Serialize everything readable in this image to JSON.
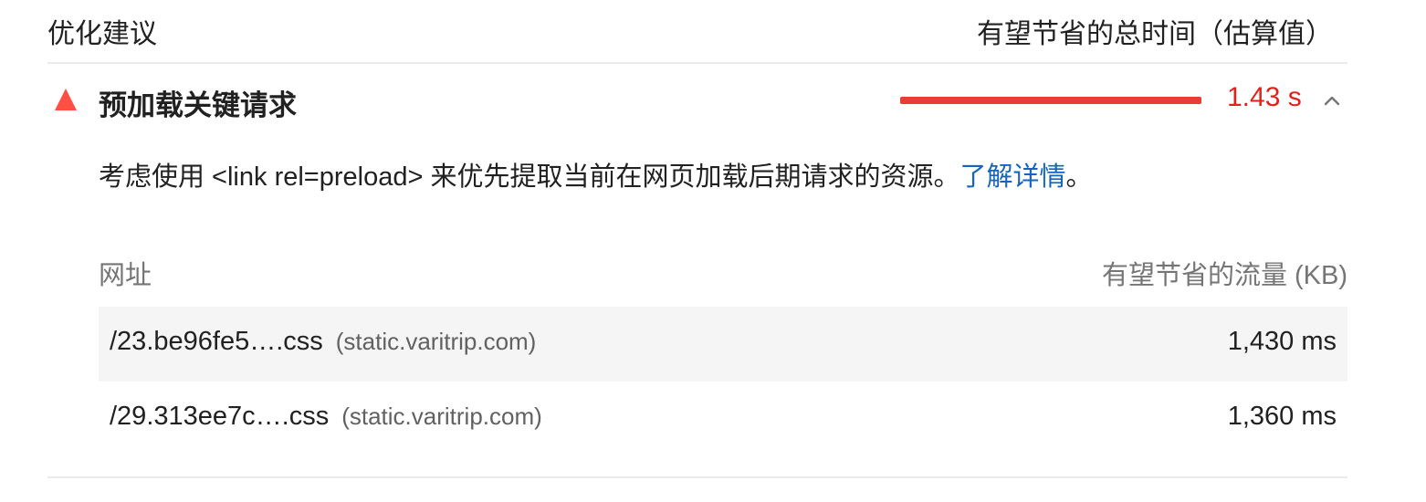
{
  "header": {
    "title": "优化建议",
    "savings_label": "有望节省的总时间（估算值）"
  },
  "audit": {
    "title": "预加载关键请求",
    "savings": "1.43 s",
    "status_color": "#ff4e42",
    "savings_color": "#e0221b",
    "description": "考虑使用 <link rel=preload> 来优先提取当前在网页加载后期请求的资源。",
    "learn_more": "了解详情",
    "description_suffix": "。",
    "expand_icon": "chevron-up-icon"
  },
  "table": {
    "columns": {
      "url": "网址",
      "savings": "有望节省的流量 (KB)"
    },
    "rows": [
      {
        "url": "/23.be96fe5….css",
        "host": "(static.varitrip.com)",
        "value": "1,430 ms"
      },
      {
        "url": "/29.313ee7c….css",
        "host": "(static.varitrip.com)",
        "value": "1,360 ms"
      }
    ]
  }
}
